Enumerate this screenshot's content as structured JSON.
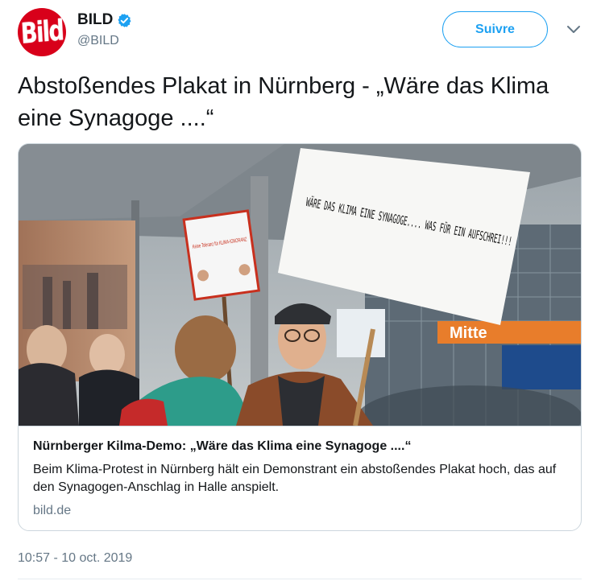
{
  "account": {
    "avatar_text": "Bild",
    "display_name": "BILD",
    "handle": "@BILD",
    "verified": true,
    "verified_icon": "verified-badge-icon"
  },
  "follow_button": {
    "label": "Suivre"
  },
  "menu_icon": "chevron-down-icon",
  "tweet": {
    "text": "Abstoßendes Plakat in Nürnberg - „Wäre das Klima eine Synagoge ....“",
    "timestamp": "10:57 - 10 oct. 2019"
  },
  "card": {
    "title": "Nürnberger Kilma-Demo: „Wäre das Klima eine Synagoge ....“",
    "description": "Beim Klima-Protest in Nürnberg hält ein Demonstrant ein abstoßendes Plakat hoch, das auf den Synagogen-Anschlag in Halle anspielt.",
    "domain": "bild.de",
    "image": {
      "main_sign_text": "WÄRE DAS KLIMA EINE SYNAGOGE.... WAS FÜR EIN AUFSCHREI!!!",
      "small_sign_text": "Keine Toleranz für KLIMA-IGNORANZ",
      "building_sign_text": "Mitte"
    }
  },
  "colors": {
    "brand_red": "#d8001a",
    "twitter_blue": "#1da1f2",
    "text": "#14171a",
    "secondary_text": "#657786",
    "border": "#ccd6dd"
  }
}
